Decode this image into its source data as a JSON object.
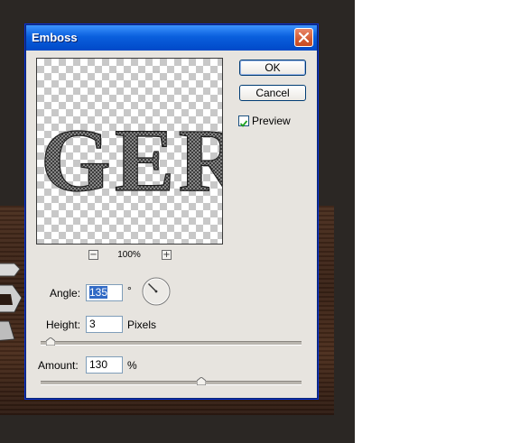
{
  "dialog": {
    "title": "Emboss",
    "ok_label": "OK",
    "cancel_label": "Cancel",
    "preview_label": "Preview",
    "preview_checked": true,
    "zoom_level": "100%",
    "preview_text": "GER"
  },
  "settings": {
    "angle_label": "Angle:",
    "angle_value": "135",
    "angle_unit": "°",
    "height_label": "Height:",
    "height_value": "3",
    "height_unit": "Pixels",
    "amount_label": "Amount:",
    "amount_value": "130",
    "amount_unit": "%",
    "height_slider_fraction": 0.02,
    "amount_slider_fraction": 0.62
  },
  "icons": {
    "close": "close-icon",
    "zoom_out": "zoom-out-icon",
    "zoom_in": "zoom-in-icon",
    "angle_dial": "angle-dial-icon",
    "checkmark": "checkmark-icon"
  },
  "colors": {
    "titlebar": "#0a5fdd",
    "close_button": "#d25b33",
    "selection": "#316ac5",
    "dialog_bg": "#e7e4df"
  }
}
